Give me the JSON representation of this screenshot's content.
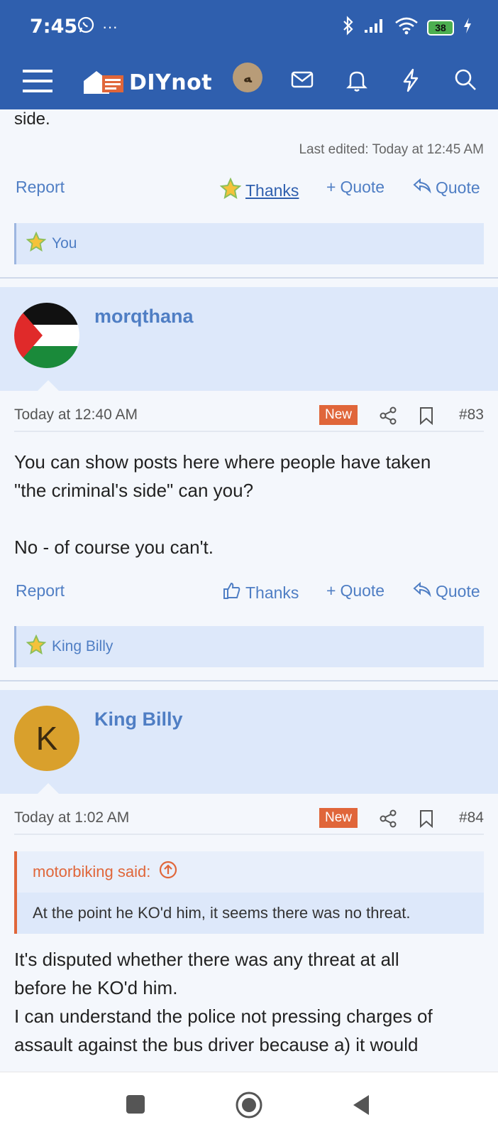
{
  "status_bar": {
    "time": "7:45",
    "more": "···",
    "battery": "38"
  },
  "app_bar": {
    "logo_text": "DIYnot",
    "user_avatar_glyph": "ﻪ"
  },
  "prev_post": {
    "text_tail": "side.",
    "last_edited": "Last edited: Today at 12:45 AM",
    "report": "Report",
    "thanks": "Thanks",
    "plus_quote": "Quote",
    "quote": "Quote",
    "reaction_user": "You"
  },
  "posts": [
    {
      "username": "morqthana",
      "date": "Today at 12:40 AM",
      "new_badge": "New",
      "number": "#83",
      "body_line1": "You can show posts here where people have taken",
      "body_line2": "\"the criminal's side\" can you?",
      "body_line3": "No - of course you can't.",
      "report": "Report",
      "thanks": "Thanks",
      "plus_quote": "Quote",
      "quote": "Quote",
      "reaction_user": "King Billy"
    },
    {
      "username": "King Billy",
      "avatar_letter": "K",
      "date": "Today at 1:02 AM",
      "new_badge": "New",
      "number": "#84",
      "quote_author": "motorbiking said:",
      "quote_text": "At the point he KO'd him, it seems there was no threat.",
      "body_line1": "It's disputed whether there was any threat at all",
      "body_line2": "before he KO'd him.",
      "body_line3": "I can understand the police not pressing charges of",
      "body_line4": "assault against the bus driver because a) it would"
    }
  ],
  "colors": {
    "header_blue": "#2f5fae",
    "link_blue": "#4f7ec4",
    "accent_orange": "#e0663a",
    "block_blue": "#dde8fa",
    "avatar_gold": "#d9a02c"
  }
}
